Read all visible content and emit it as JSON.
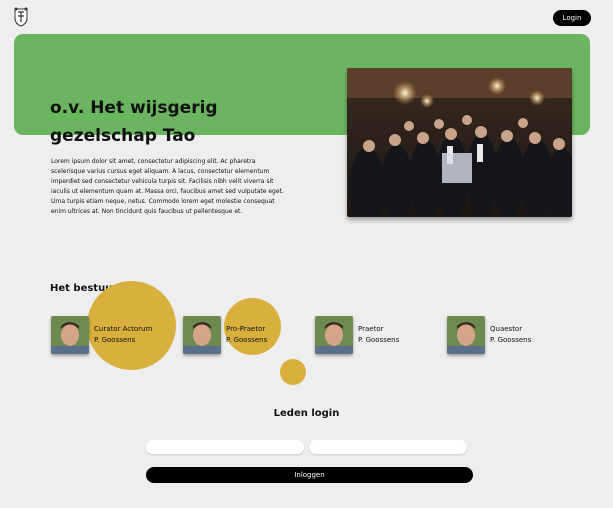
{
  "header": {
    "logo_icon": "society-crest-icon",
    "login_label": "Login"
  },
  "hero": {
    "title": "o.v. Het wijsgerig gezelschap Tao",
    "body": "Lorem ipsum dolor sit amet, consectetur adipiscing elit. Ac pharetra scelerisque varius cursus eget aliquam. A lacus, consectetur elementum imperdiet sed consectetur vehicula turpis sit. Facilisis nibh velit viverra sit iaculis ut elementum quam at. Massa orci, faucibus amet sed vulputate eget. Urna turpis etiam neque, netus. Commodo lorem eget molestie consequat enim ultrices at. Non tincidunt quis faucibus ut pellentesque et.",
    "accent_color": "#6cb560"
  },
  "board": {
    "title": "Het bestuur",
    "members": [
      {
        "role": "Curator Actorum",
        "name": "P. Goossens"
      },
      {
        "role": "Pro-Praetor",
        "name": "P. Goossens"
      },
      {
        "role": "Praetor",
        "name": "P. Goossens"
      },
      {
        "role": "Quaestor",
        "name": "P. Goossens"
      }
    ],
    "blob_color": "#d9b03d"
  },
  "login": {
    "title": "Leden login",
    "username_placeholder": "",
    "password_placeholder": "",
    "submit_label": "Inloggen"
  }
}
